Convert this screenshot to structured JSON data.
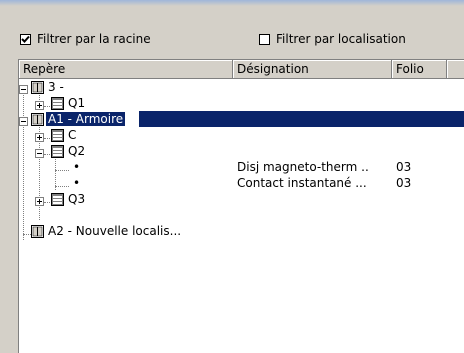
{
  "filters": {
    "root": {
      "label": "Filtrer par la racine",
      "checked": true
    },
    "location": {
      "label": "Filtrer par localisation",
      "checked": false
    }
  },
  "columns": [
    "Repère",
    "Désignation",
    "Folio"
  ],
  "tree": {
    "n3": "3 -",
    "q1": "Q1",
    "a1": "A1 - Armoire",
    "c": "C",
    "q2": "Q2",
    "item1": {
      "label": "•",
      "designation": "Disj magneto-therm ..",
      "folio": "03"
    },
    "item2": {
      "label": "•",
      "designation": "Contact instantané ...",
      "folio": "03"
    },
    "q3": "Q3",
    "a2": "A2 - Nouvelle localis..."
  },
  "colors": {
    "selection": "#0a246a",
    "face": "#d4d0c8",
    "panel": "#ffffff"
  },
  "icons": {
    "location": "cabinet-location-icon",
    "component": "component-rack-icon",
    "expand": "plus-box-icon",
    "collapse": "minus-box-icon",
    "check": "check-mark-icon"
  }
}
